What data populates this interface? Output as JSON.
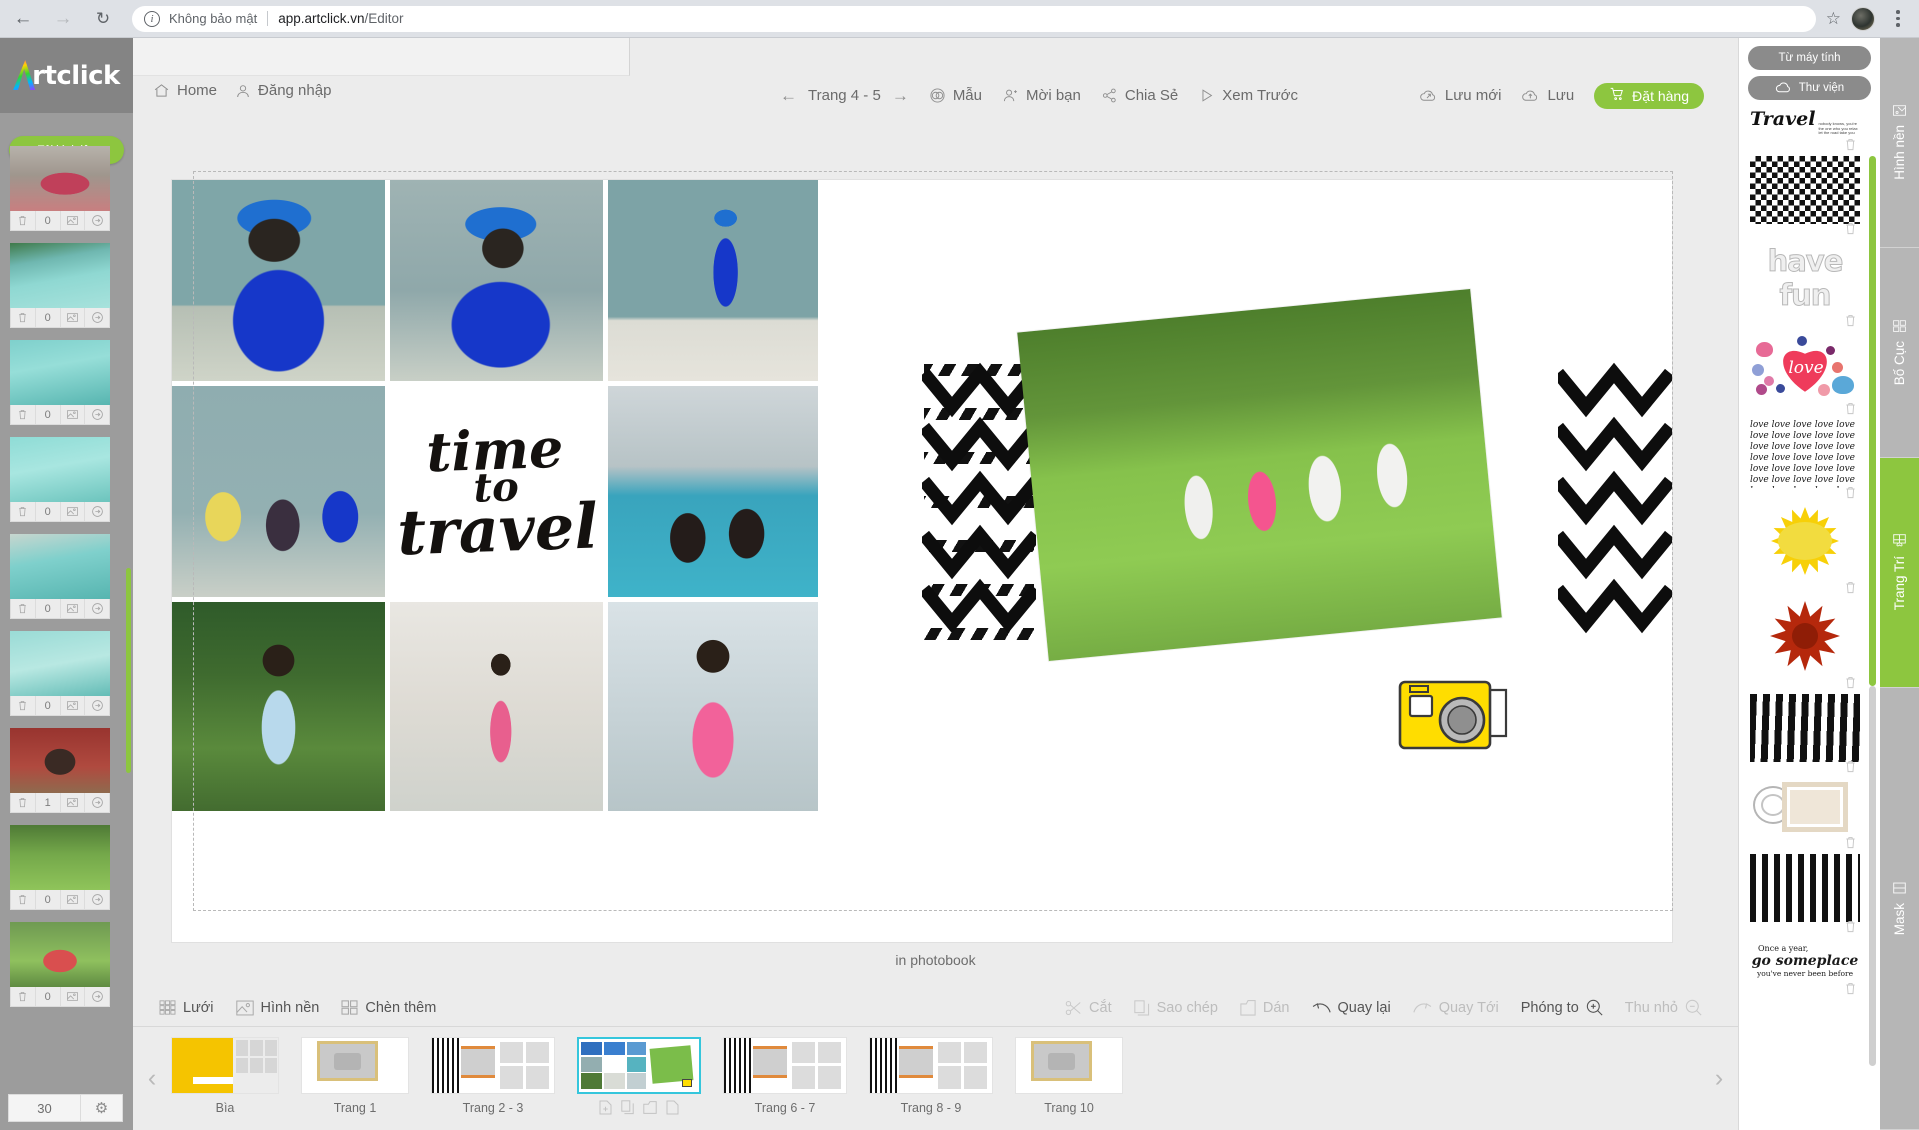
{
  "browser": {
    "back_icon": "back-arrow-icon",
    "forward_icon": "forward-arrow-icon",
    "reload_icon": "reload-icon",
    "info_icon": "info-icon",
    "security_label": "Không bảo mật",
    "url_host": "app.artclick.vn",
    "url_path": "/Editor",
    "star_icon": "bookmark-star-icon",
    "profile_icon": "avatar",
    "menu_icon": "kebab-menu-icon"
  },
  "brand": {
    "name": "rtclick"
  },
  "left_rail": {
    "upload_label": "Tải hình lên",
    "photo_count": "30",
    "settings_icon": "gear-icon",
    "thumb_controls": {
      "delete_icon": "trash-icon",
      "used_count": "0",
      "image_icon": "image-icon",
      "insert_icon": "arrow-right-icon"
    },
    "photos": [
      {
        "used": "0"
      },
      {
        "used": "0"
      },
      {
        "used": "0"
      },
      {
        "used": "0"
      },
      {
        "used": "0"
      },
      {
        "used": "0"
      },
      {
        "used": "1"
      },
      {
        "used": "0"
      },
      {
        "used": "0"
      }
    ]
  },
  "topbar": {
    "home_label": "Home",
    "login_label": "Đăng nhập",
    "prev_icon": "arrow-left-icon",
    "next_icon": "arrow-right-icon",
    "page_indicator": "Trang 4 - 5",
    "items": [
      {
        "label": "Mẫu",
        "icon": "template-icon"
      },
      {
        "label": "Mời bạn",
        "icon": "invite-user-icon"
      },
      {
        "label": "Chia Sẻ",
        "icon": "share-icon"
      },
      {
        "label": "Xem Trước",
        "icon": "play-preview-icon"
      },
      {
        "label": "Lưu mới",
        "icon": "save-as-cloud-icon"
      },
      {
        "label": "Lưu",
        "icon": "save-cloud-icon"
      }
    ],
    "order_label": "Đặt hàng",
    "order_icon": "cart-icon",
    "order_color": "#8dc63f"
  },
  "canvas": {
    "caption": "in photobook",
    "headline_line1": "time",
    "headline_line2": "to",
    "headline_line3": "travel",
    "camera_sticker": "camera-sticker"
  },
  "editbar": {
    "left": [
      {
        "label": "Lưới",
        "icon": "grid-icon",
        "state": "enabled"
      },
      {
        "label": "Hình nền",
        "icon": "background-image-icon",
        "state": "enabled"
      },
      {
        "label": "Chèn thêm",
        "icon": "add-frame-icon",
        "state": "enabled"
      }
    ],
    "right": [
      {
        "label": "Cắt",
        "icon": "scissors-icon",
        "state": "disabled"
      },
      {
        "label": "Sao chép",
        "icon": "copy-icon",
        "state": "disabled"
      },
      {
        "label": "Dán",
        "icon": "paste-icon",
        "state": "disabled"
      },
      {
        "label": "Quay lại",
        "icon": "undo-icon",
        "state": "enabled"
      },
      {
        "label": "Quay Tới",
        "icon": "redo-icon",
        "state": "disabled"
      },
      {
        "label": "Phóng to",
        "icon": "zoom-in-icon",
        "state": "enabled"
      },
      {
        "label": "Thu nhỏ",
        "icon": "zoom-out-icon",
        "state": "disabled"
      }
    ]
  },
  "pagestrip": {
    "prev_icon": "chevron-left-icon",
    "next_icon": "chevron-right-icon",
    "selected": "Trang 4 - 5",
    "row_actions": [
      {
        "icon": "add-page-icon"
      },
      {
        "icon": "duplicate-page-icon"
      },
      {
        "icon": "folder-icon"
      },
      {
        "icon": "delete-page-icon"
      }
    ],
    "pages": [
      {
        "label": "Bìa",
        "kind": "cover"
      },
      {
        "label": "Trang 1",
        "kind": "single"
      },
      {
        "label": "Trang 2 - 3",
        "kind": "spread"
      },
      {
        "label": "",
        "kind": "spread-selected"
      },
      {
        "label": "Trang 6 - 7",
        "kind": "spread"
      },
      {
        "label": "Trang 8 - 9",
        "kind": "spread"
      },
      {
        "label": "Trang 10",
        "kind": "single"
      }
    ]
  },
  "right_panel": {
    "source_buttons": [
      {
        "label": "Từ máy tính",
        "icon": "computer-upload-icon"
      },
      {
        "label": "Thư viện",
        "icon": "cloud-icon"
      }
    ],
    "delete_icon": "trash-icon",
    "stickers": [
      {
        "name": "travel-word-art",
        "caption": "Travel"
      },
      {
        "name": "black-white-diamond-pattern",
        "caption": ""
      },
      {
        "name": "have-fun-word-art",
        "caption": "have fun"
      },
      {
        "name": "love-heart-watercolor",
        "caption": "love"
      },
      {
        "name": "love-script-pattern",
        "caption": ""
      },
      {
        "name": "yellow-sun-burst",
        "caption": ""
      },
      {
        "name": "red-star-burst",
        "caption": ""
      },
      {
        "name": "black-brush-dashes-pattern",
        "caption": ""
      },
      {
        "name": "vintage-postage-frame",
        "caption": ""
      },
      {
        "name": "black-squares-pattern",
        "caption": ""
      },
      {
        "name": "once-a-year-quote",
        "caption": "Once a year, go someplace you've never been before"
      }
    ]
  },
  "vtabs": [
    {
      "label": "Hình nền",
      "icon": "image-icon",
      "active": false
    },
    {
      "label": "Bố Cục",
      "icon": "layout-grid-icon",
      "active": false
    },
    {
      "label": "Trang Trí",
      "icon": "decoration-icon",
      "active": true
    },
    {
      "label": "Mask",
      "icon": "mask-icon",
      "active": false
    }
  ]
}
